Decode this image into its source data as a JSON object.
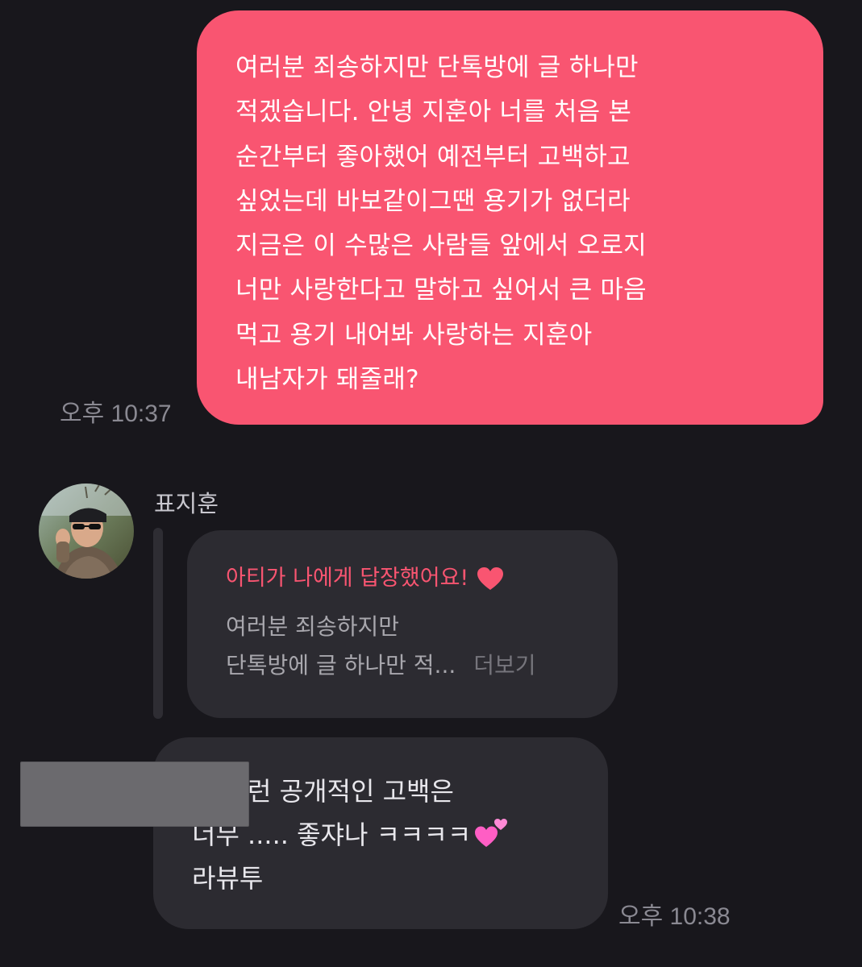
{
  "sent_message": {
    "lines": [
      "여러분 죄송하지만 단톡방에 글 하나만",
      "적겠습니다. 안녕 지훈아 너를 처음 본",
      "순간부터 좋아했어 예전부터 고백하고",
      "싶었는데 바보같이그땐 용기가 없더라",
      "지금은 이 수많은 사람들 앞에서 오로지",
      "너만 사랑한다고 말하고 싶어서 큰 마음",
      "먹고 용기 내어봐 사랑하는 지훈아",
      "내남자가 돼줄래?"
    ],
    "time": "오후 10:37"
  },
  "reply": {
    "sender_name": "표지훈",
    "avatar_icon": "profile-photo",
    "card_title": "아티가 나에게 답장했어요!",
    "card_icon": "heart-icon",
    "quote_lines": [
      "여러분 죄송하지만",
      "단톡방에 글 하나만 적..."
    ],
    "more_label": "더보기",
    "message_lines": [
      "아 이런 공개적인 고백은",
      "너무 ..... 좋쟈나 ㅋㅋㅋㅋ",
      "라뷰투"
    ],
    "message_icon": "two-hearts-icon",
    "time": "오후 10:38"
  },
  "colors": {
    "background": "#18171c",
    "sent_bubble": "#f95571",
    "received_bubble": "#2c2b31",
    "accent": "#f95571"
  }
}
